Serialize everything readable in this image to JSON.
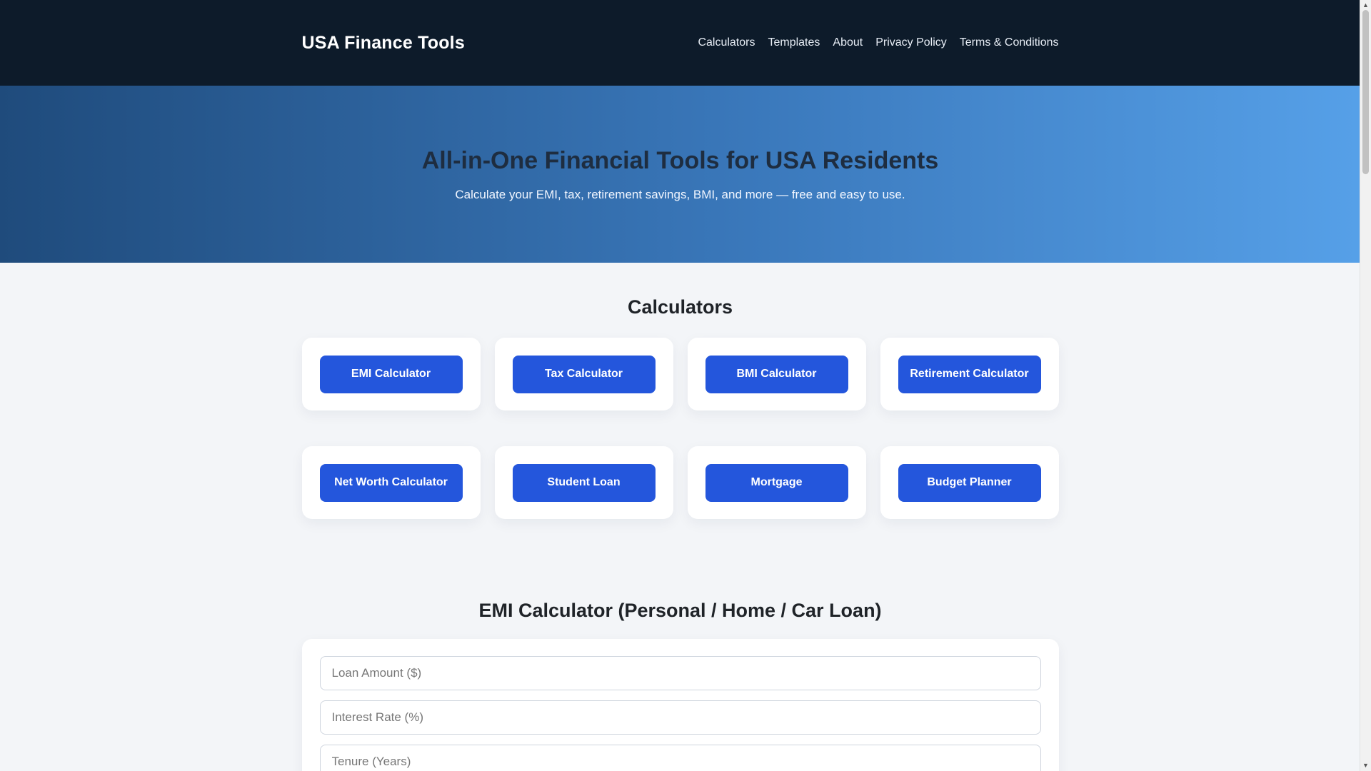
{
  "header": {
    "brand": "USA Finance Tools",
    "nav": [
      "Calculators",
      "Templates",
      "About",
      "Privacy Policy",
      "Terms & Conditions"
    ]
  },
  "hero": {
    "title": "All-in-One Financial Tools for USA Residents",
    "subtitle": "Calculate your EMI, tax, retirement savings, BMI, and more — free and easy to use."
  },
  "calculators": {
    "title": "Calculators",
    "items": [
      "EMI Calculator",
      "Tax Calculator",
      "BMI Calculator",
      "Retirement Calculator",
      "Net Worth Calculator",
      "Student Loan",
      "Mortgage",
      "Budget Planner"
    ]
  },
  "emi": {
    "title": "EMI Calculator (Personal / Home / Car Loan)",
    "fields": [
      {
        "placeholder": "Loan Amount ($)"
      },
      {
        "placeholder": "Interest Rate (%)"
      },
      {
        "placeholder": "Tenure (Years)"
      }
    ]
  },
  "colors": {
    "header_bg": "#0d1b2a",
    "button_bg": "#2456dc",
    "hero_gradient_start": "#1f4b7c",
    "hero_gradient_end": "#56a0e8"
  },
  "icons": {
    "scroll_up": "scroll-up-arrow-icon",
    "scroll_down": "scroll-down-arrow-icon"
  }
}
